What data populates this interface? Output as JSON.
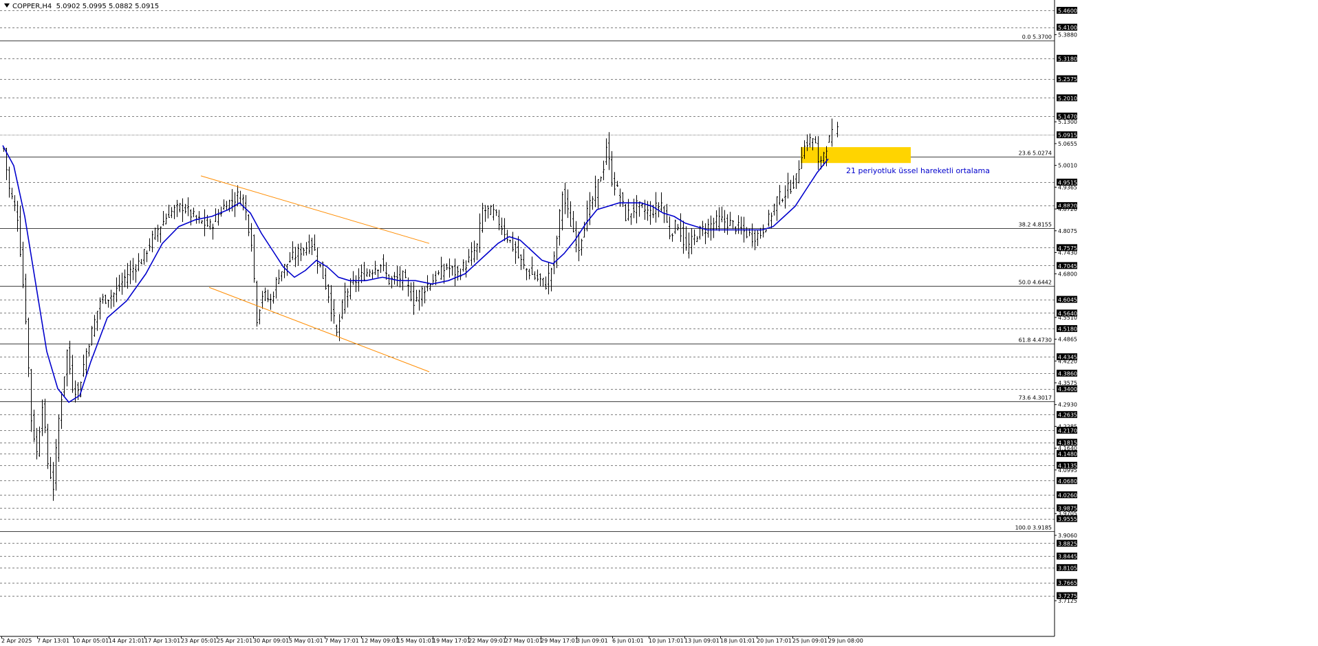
{
  "header": {
    "symbol_timeframe": "COPPER,H4",
    "ohlc": "5.0902 5.0995 5.0882 5.0915"
  },
  "annotation": {
    "ema_label": "21 periyotluk üssel hareketli ortalama"
  },
  "colors": {
    "background": "#ffffff",
    "price_line": "#000000",
    "ema": "#0000cc",
    "channel": "#ff8c00",
    "zone": "#ffd400",
    "label_bg": "#000000",
    "label_text": "#ffffff"
  },
  "chart_data": {
    "type": "candlestick",
    "symbol": "COPPER",
    "timeframe": "H4",
    "ylim": [
      3.68,
      5.47
    ],
    "y_tick_labels": [
      "5.4600",
      "5.4100",
      "5.3880",
      "5.3180",
      "5.2575",
      "5.2010",
      "5.1470",
      "5.1300",
      "5.0915",
      "5.0655",
      "5.0010",
      "4.9515",
      "4.9365",
      "4.8820",
      "4.8720",
      "4.8075",
      "4.7575",
      "4.7430",
      "4.7045",
      "4.6800",
      "4.6045",
      "4.5640",
      "4.5510",
      "4.5180",
      "4.4865",
      "4.4345",
      "4.4220",
      "4.3860",
      "4.3575",
      "4.3400",
      "4.2930",
      "4.2635",
      "4.2285",
      "4.2170",
      "4.1815",
      "4.1640",
      "4.1480",
      "4.1135",
      "4.0995",
      "4.0680",
      "4.0260",
      "3.9875",
      "3.9705",
      "3.9555",
      "3.9060",
      "3.8825",
      "3.8445",
      "3.8105",
      "3.7665",
      "3.7275",
      "3.7125"
    ],
    "x_tick_labels": [
      "2 Apr 2025",
      "7 Apr 13:01",
      "10 Apr 05:01",
      "14 Apr 21:01",
      "17 Apr 13:01",
      "23 Apr 05:01",
      "25 Apr 21:01",
      "30 Apr 09:01",
      "5 May 01:01",
      "7 May 17:01",
      "12 May 09:01",
      "15 May 01:01",
      "19 May 17:01",
      "22 May 09:01",
      "27 May 01:01",
      "29 May 17:01",
      "3 Jun 09:01",
      "6 Jun 01:01",
      "10 Jun 17:01",
      "13 Jun 09:01",
      "18 Jun 01:01",
      "20 Jun 17:01",
      "25 Jun 09:01",
      "29 Jun 08:00"
    ],
    "price_levels": [
      5.46,
      5.41,
      5.318,
      5.2575,
      5.201,
      5.147,
      5.0915,
      4.9515,
      4.882,
      4.7575,
      4.7045,
      4.6045,
      4.564,
      4.518,
      4.4345,
      4.386,
      4.34,
      4.2635,
      4.217,
      4.1815,
      4.148,
      4.1135,
      4.068,
      4.026,
      3.9875,
      3.9555,
      3.8825,
      3.8445,
      3.8105,
      3.7665,
      3.7275
    ],
    "current_price": 5.0915,
    "fibonacci": [
      {
        "label": "0.0 5.3700",
        "value": 5.37
      },
      {
        "label": "23.6 5.0274",
        "value": 5.0274
      },
      {
        "label": "38.2 4.8155",
        "value": 4.8155
      },
      {
        "label": "50.0 4.6442",
        "value": 4.6442
      },
      {
        "label": "61.8 4.4730",
        "value": 4.473
      },
      {
        "label": "73.6 4.3017",
        "value": 4.3017
      },
      {
        "label": "100.0 3.9185",
        "value": 3.9185
      }
    ],
    "zone": {
      "t0": 290,
      "t1": 330,
      "y_low": 5.008,
      "y_high": 5.055
    },
    "channel_lines": [
      {
        "t0": 72,
        "v0": 4.97,
        "t1": 155,
        "v1": 4.77
      },
      {
        "t0": 75,
        "v0": 4.64,
        "t1": 155,
        "v1": 4.39
      }
    ],
    "anchors": [
      [
        0,
        5.05
      ],
      [
        2,
        4.93
      ],
      [
        5,
        4.85
      ],
      [
        8,
        4.55
      ],
      [
        10,
        4.25
      ],
      [
        12,
        4.15
      ],
      [
        14,
        4.3
      ],
      [
        16,
        4.12
      ],
      [
        18,
        4.05
      ],
      [
        20,
        4.25
      ],
      [
        23,
        4.45
      ],
      [
        25,
        4.35
      ],
      [
        27,
        4.33
      ],
      [
        30,
        4.45
      ],
      [
        35,
        4.6
      ],
      [
        40,
        4.62
      ],
      [
        45,
        4.68
      ],
      [
        50,
        4.72
      ],
      [
        55,
        4.8
      ],
      [
        60,
        4.86
      ],
      [
        65,
        4.88
      ],
      [
        70,
        4.84
      ],
      [
        75,
        4.82
      ],
      [
        80,
        4.88
      ],
      [
        85,
        4.91
      ],
      [
        87,
        4.9
      ],
      [
        90,
        4.78
      ],
      [
        92,
        4.55
      ],
      [
        94,
        4.62
      ],
      [
        97,
        4.6
      ],
      [
        100,
        4.68
      ],
      [
        104,
        4.72
      ],
      [
        108,
        4.75
      ],
      [
        112,
        4.77
      ],
      [
        115,
        4.7
      ],
      [
        118,
        4.62
      ],
      [
        121,
        4.5
      ],
      [
        124,
        4.62
      ],
      [
        128,
        4.66
      ],
      [
        133,
        4.69
      ],
      [
        137,
        4.71
      ],
      [
        140,
        4.66
      ],
      [
        145,
        4.67
      ],
      [
        149,
        4.6
      ],
      [
        153,
        4.64
      ],
      [
        157,
        4.67
      ],
      [
        161,
        4.7
      ],
      [
        165,
        4.68
      ],
      [
        169,
        4.72
      ],
      [
        172,
        4.76
      ],
      [
        174,
        4.87
      ],
      [
        178,
        4.86
      ],
      [
        181,
        4.82
      ],
      [
        185,
        4.76
      ],
      [
        189,
        4.7
      ],
      [
        193,
        4.67
      ],
      [
        197,
        4.65
      ],
      [
        200,
        4.72
      ],
      [
        203,
        4.92
      ],
      [
        206,
        4.83
      ],
      [
        209,
        4.76
      ],
      [
        212,
        4.86
      ],
      [
        215,
        4.92
      ],
      [
        218,
        5.0
      ],
      [
        219,
        5.06
      ],
      [
        221,
        4.96
      ],
      [
        224,
        4.91
      ],
      [
        226,
        4.85
      ],
      [
        230,
        4.88
      ],
      [
        235,
        4.86
      ],
      [
        239,
        4.89
      ],
      [
        242,
        4.8
      ],
      [
        245,
        4.83
      ],
      [
        248,
        4.75
      ],
      [
        252,
        4.8
      ],
      [
        256,
        4.82
      ],
      [
        260,
        4.84
      ],
      [
        264,
        4.83
      ],
      [
        268,
        4.81
      ],
      [
        272,
        4.79
      ],
      [
        275,
        4.8
      ],
      [
        278,
        4.84
      ],
      [
        281,
        4.9
      ],
      [
        284,
        4.92
      ],
      [
        288,
        4.96
      ],
      [
        290,
        5.04
      ],
      [
        292,
        5.07
      ],
      [
        294,
        5.08
      ],
      [
        295,
        5.06
      ],
      [
        296,
        5.0
      ],
      [
        297,
        5.02
      ],
      [
        299,
        5.06
      ],
      [
        301,
        5.09
      ],
      [
        302,
        5.11
      ],
      [
        303,
        5.1
      ]
    ],
    "ema_anchors": [
      [
        0,
        5.06
      ],
      [
        4,
        5.0
      ],
      [
        8,
        4.85
      ],
      [
        12,
        4.65
      ],
      [
        16,
        4.45
      ],
      [
        20,
        4.34
      ],
      [
        24,
        4.3
      ],
      [
        28,
        4.32
      ],
      [
        32,
        4.42
      ],
      [
        38,
        4.55
      ],
      [
        45,
        4.6
      ],
      [
        52,
        4.68
      ],
      [
        58,
        4.77
      ],
      [
        64,
        4.82
      ],
      [
        70,
        4.84
      ],
      [
        76,
        4.85
      ],
      [
        82,
        4.87
      ],
      [
        86,
        4.89
      ],
      [
        90,
        4.86
      ],
      [
        94,
        4.8
      ],
      [
        98,
        4.75
      ],
      [
        102,
        4.7
      ],
      [
        106,
        4.67
      ],
      [
        110,
        4.69
      ],
      [
        114,
        4.72
      ],
      [
        118,
        4.7
      ],
      [
        122,
        4.67
      ],
      [
        126,
        4.66
      ],
      [
        132,
        4.66
      ],
      [
        138,
        4.67
      ],
      [
        144,
        4.66
      ],
      [
        150,
        4.66
      ],
      [
        156,
        4.65
      ],
      [
        162,
        4.66
      ],
      [
        168,
        4.68
      ],
      [
        172,
        4.71
      ],
      [
        176,
        4.74
      ],
      [
        180,
        4.77
      ],
      [
        184,
        4.79
      ],
      [
        188,
        4.78
      ],
      [
        192,
        4.75
      ],
      [
        196,
        4.72
      ],
      [
        200,
        4.71
      ],
      [
        204,
        4.74
      ],
      [
        208,
        4.78
      ],
      [
        212,
        4.83
      ],
      [
        216,
        4.87
      ],
      [
        220,
        4.88
      ],
      [
        224,
        4.89
      ],
      [
        228,
        4.89
      ],
      [
        232,
        4.89
      ],
      [
        236,
        4.88
      ],
      [
        240,
        4.86
      ],
      [
        244,
        4.85
      ],
      [
        248,
        4.83
      ],
      [
        252,
        4.82
      ],
      [
        256,
        4.81
      ],
      [
        260,
        4.81
      ],
      [
        264,
        4.81
      ],
      [
        268,
        4.81
      ],
      [
        272,
        4.81
      ],
      [
        276,
        4.81
      ],
      [
        280,
        4.82
      ],
      [
        284,
        4.85
      ],
      [
        288,
        4.88
      ],
      [
        292,
        4.93
      ],
      [
        296,
        4.98
      ],
      [
        300,
        5.02
      ]
    ],
    "bar_count": 304,
    "gap_after": 302,
    "grid": "dashed horizontal",
    "legend": "none"
  }
}
